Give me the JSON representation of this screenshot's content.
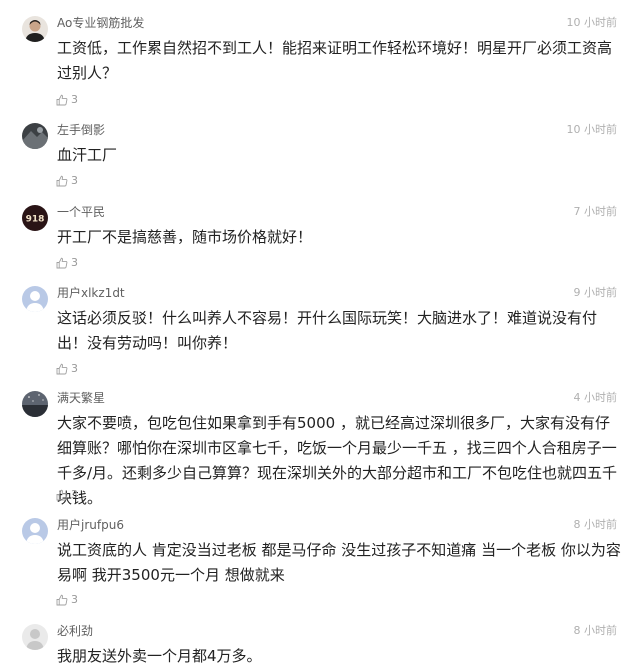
{
  "comments": [
    {
      "username": "Ao专业钢筋批发",
      "time": "10 小时前",
      "text": "工资低，工作累自然招不到工人！能招来证明工作轻松环境好！明星开厂必须工资高过别人？",
      "likes": "3",
      "avatar": "man-portrait-avatar"
    },
    {
      "username": "左手倒影",
      "time": "10 小时前",
      "text": "血汗工厂",
      "likes": "3",
      "avatar": "dark-photo-avatar"
    },
    {
      "username": "一个平民",
      "time": "7 小时前",
      "text": "开工厂不是搞慈善，随市场价格就好！",
      "likes": "3",
      "avatar": "918-badge-avatar",
      "avatar_text": "918"
    },
    {
      "username": "用户xlkz1dt",
      "time": "9 小时前",
      "text": "这话必须反驳！什么叫养人不容易！开什么国际玩笑！大脑进水了！难道说没有付出！没有劳动吗！叫你养！",
      "likes": "3",
      "avatar": "default-user-avatar"
    },
    {
      "username": "满天繁星",
      "time": "4 小时前",
      "text": "大家不要喷，包吃包住如果拿到手有5000 ，就已经高过深圳很多厂，大家有没有仔细算账？哪怕你在深圳市区拿七千，吃饭一个月最少一千五 ，找三四个人合租房子一千多/月。还剩多少自己算算？现在深圳关外的大部分超市和工厂不包吃住也就四五千块钱。",
      "likes": "3",
      "avatar": "night-sky-avatar"
    },
    {
      "username": "用户jrufpu6",
      "time": "8 小时前",
      "text": "说工资底的人 肯定没当过老板 都是马仔命 没生过孩子不知道痛 当一个老板 你以为容易啊 我开3500元一个月 想做就来",
      "likes": "3",
      "avatar": "default-user-avatar"
    },
    {
      "username": "必利劲",
      "time": "8 小时前",
      "text": "我朋友送外卖一个月都4万多。",
      "likes": "",
      "avatar": "grey-user-avatar"
    }
  ],
  "colors": {
    "username": "#606060",
    "time": "#b0b0b0",
    "text": "#222222",
    "like": "#999999",
    "default_avatar_bg": "#b9c9e6"
  }
}
